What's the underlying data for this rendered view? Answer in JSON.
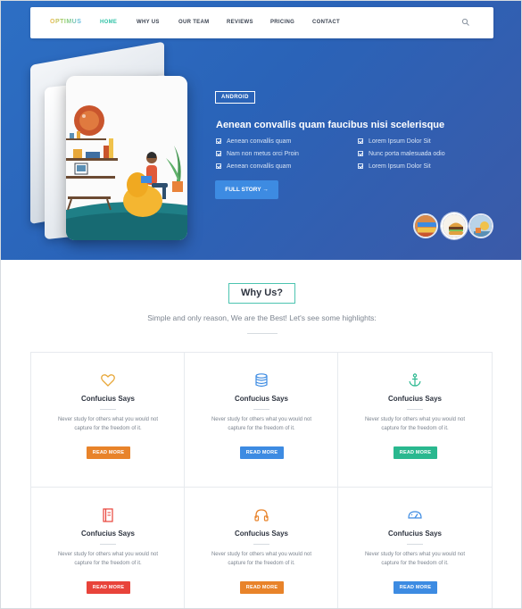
{
  "nav": {
    "logo": "OPTIMUS",
    "items": [
      "HOME",
      "WHY US",
      "OUR TEAM",
      "REVIEWS",
      "PRICING",
      "CONTACT"
    ],
    "active": "HOME",
    "search_icon": "search-icon"
  },
  "hero": {
    "badge": "ANDROID",
    "title": "Aenean convallis quam faucibus nisi scelerisque",
    "features_left": [
      "Aenean convallis quam",
      "Nam non metus orci Proin",
      "Aenean convallis quam"
    ],
    "features_right": [
      "Lorem Ipsum Dolor Sit",
      "Nunc porta malesuada odio",
      "Lorem Ipsum Dolor Sit"
    ],
    "button_label": "FULL STORY",
    "button_icon": "arrow-right-icon"
  },
  "why": {
    "heading": "Why Us?",
    "subtitle": "Simple and only reason, We are the Best! Let's see some highlights:"
  },
  "features": [
    {
      "icon": "heart-icon",
      "title": "Confucius Says",
      "text": "Never study for others what you would not capture for the freedom of it.",
      "button": "READ MORE",
      "color": "#e8832a"
    },
    {
      "icon": "database-icon",
      "title": "Confucius Says",
      "text": "Never study for others what you would not capture for the freedom of it.",
      "button": "READ MORE",
      "color": "#3d8be2"
    },
    {
      "icon": "anchor-icon",
      "title": "Confucius Says",
      "text": "Never study for others what you would not capture for the freedom of it.",
      "button": "READ MORE",
      "color": "#2ab88f"
    },
    {
      "icon": "book-icon",
      "title": "Confucius Says",
      "text": "Never study for others what you would not capture for the freedom of it.",
      "button": "READ MORE",
      "color": "#e8433a"
    },
    {
      "icon": "headphones-icon",
      "title": "Confucius Says",
      "text": "Never study for others what you would not capture for the freedom of it.",
      "button": "READ MORE",
      "color": "#e8832a"
    },
    {
      "icon": "gauge-icon",
      "title": "Confucius Says",
      "text": "Never study for others what you would not capture for the freedom of it.",
      "button": "READ MORE",
      "color": "#3d8be2"
    }
  ],
  "colors": {
    "accent_teal": "#33c3a8",
    "hero_blue": "#2d6fc4"
  }
}
